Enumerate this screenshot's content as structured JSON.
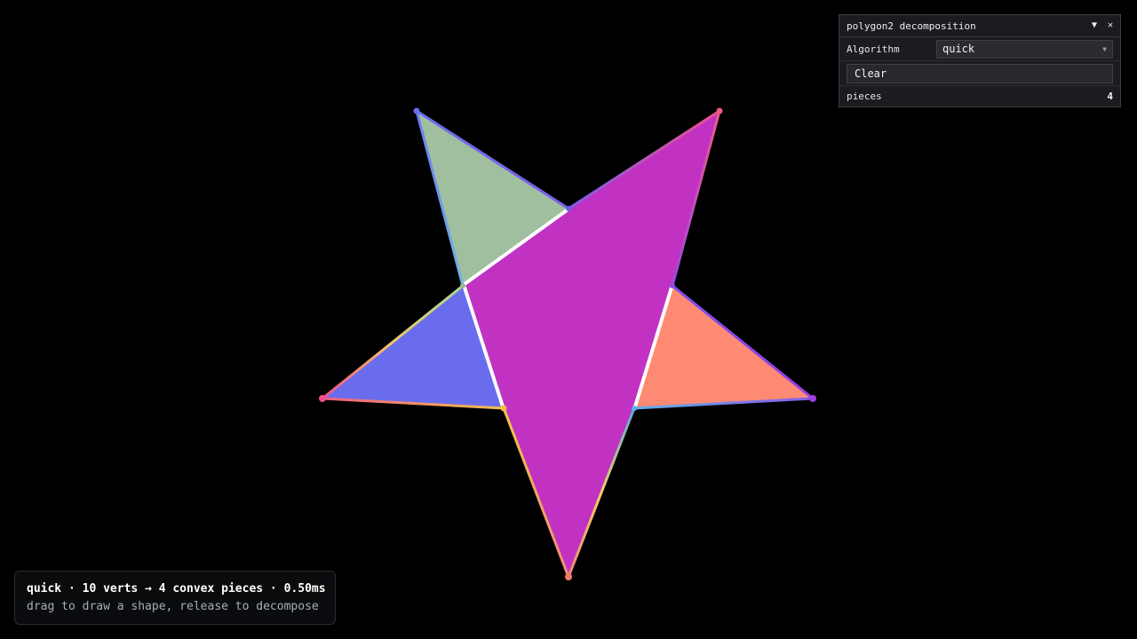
{
  "panel": {
    "title": "polygon2 decomposition",
    "collapse_icon": "triangle-down-icon",
    "close_icon": "close-icon",
    "algorithm_label": "Algorithm",
    "algorithm_value": "quick",
    "clear_label": "Clear",
    "pieces_label": "pieces",
    "pieces_value": "4"
  },
  "info": {
    "line1": "quick · 10 verts → 4 convex pieces · 0.50ms",
    "line2": "drag to draw a shape, release to decompose"
  },
  "colors": {
    "background": "#000000",
    "piece_center": "#c132c2",
    "piece_top_left": "#9fbf9e",
    "piece_left": "#6a6cee",
    "piece_right": "#ff8a73",
    "separator": "#ffffff"
  }
}
